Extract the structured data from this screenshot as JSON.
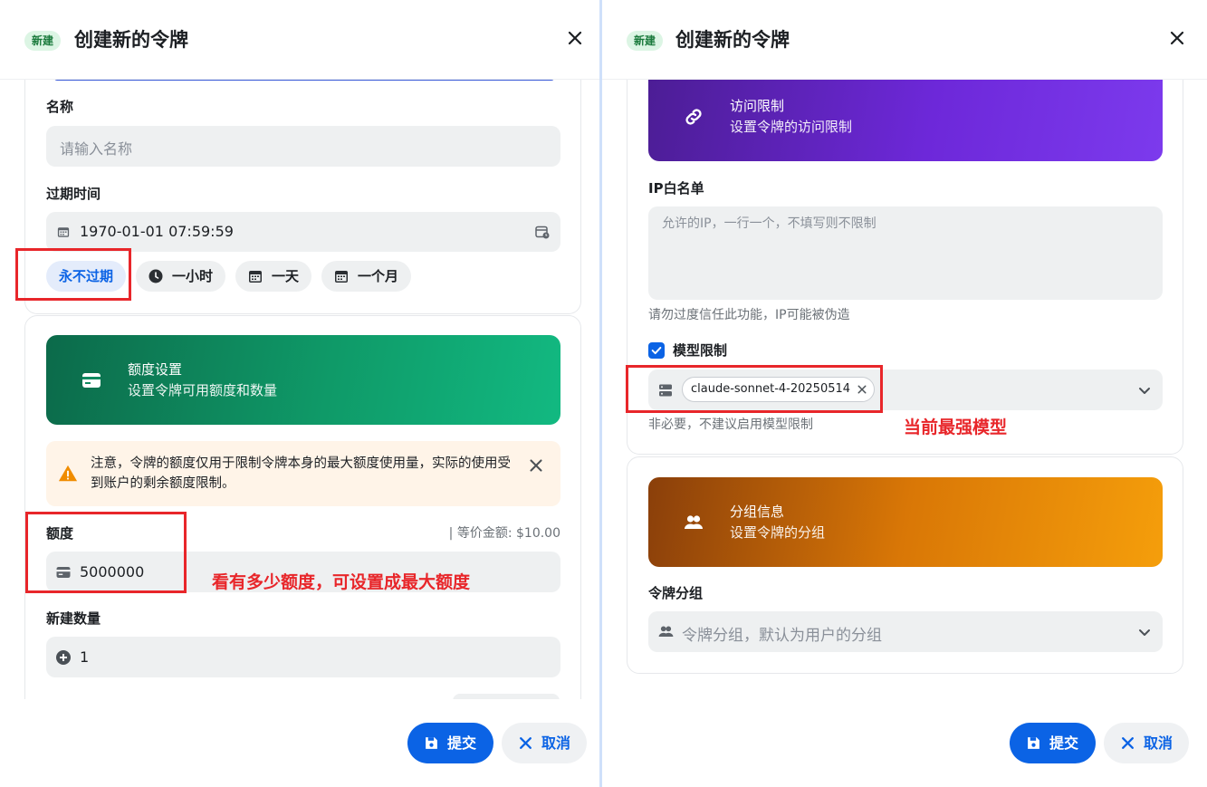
{
  "left": {
    "header": {
      "badge": "新建",
      "title": "创建新的令牌"
    },
    "name": {
      "label": "名称",
      "placeholder": "请输入名称"
    },
    "expiry": {
      "label": "过期时间",
      "value": "1970-01-01 07:59:59",
      "presets": [
        "永不过期",
        "一小时",
        "一天",
        "一个月"
      ]
    },
    "quota_banner": {
      "title": "额度设置",
      "subtitle": "设置令牌可用额度和数量"
    },
    "notice": {
      "text": "注意，令牌的额度仅用于限制令牌本身的最大额度使用量，实际的使用受到账户的剩余额度限制。"
    },
    "quota": {
      "label": "额度",
      "equivalent": "| 等价金额: $10.00",
      "value": "5000000"
    },
    "count": {
      "label": "新建数量",
      "value": "1"
    },
    "annotation": "看有多少额度，可设置成最大额度",
    "footer": {
      "submit": "提交",
      "cancel": "取消"
    }
  },
  "right": {
    "header": {
      "badge": "新建",
      "title": "创建新的令牌"
    },
    "access_banner": {
      "title": "访问限制",
      "subtitle": "设置令牌的访问限制"
    },
    "ip_whitelist": {
      "label": "IP白名单",
      "placeholder": "允许的IP，一行一个，不填写则不限制",
      "hint": "请勿过度信任此功能，IP可能被伪造"
    },
    "model_limit": {
      "label": "模型限制",
      "checked": true,
      "selected_model": "claude-sonnet-4-20250514",
      "hint": "非必要，不建议启用模型限制"
    },
    "annotation": "当前最强模型",
    "group_banner": {
      "title": "分组信息",
      "subtitle": "设置令牌的分组"
    },
    "group": {
      "label": "令牌分组",
      "placeholder": "令牌分组，默认为用户的分组"
    },
    "footer": {
      "submit": "提交",
      "cancel": "取消"
    }
  },
  "colors": {
    "primary": "#0b63e5",
    "annotation_red": "#e8262a",
    "quota_banner": "#0f8a5f",
    "access_banner": "#6d28d9",
    "group_banner": "#e08a0b",
    "warning": "#f08c00"
  }
}
